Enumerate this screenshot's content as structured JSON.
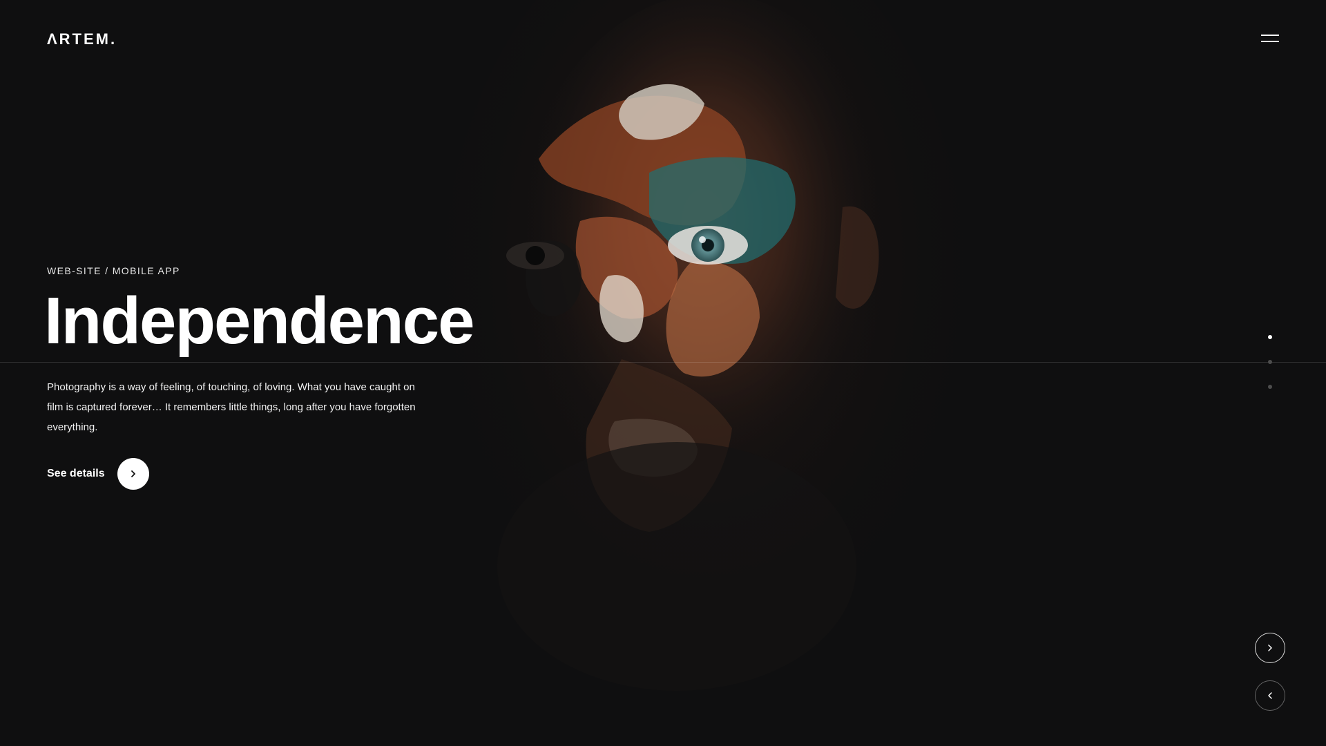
{
  "brand": {
    "logo_text": "ΛRTEM."
  },
  "header": {
    "menu_icon": "hamburger-menu-icon"
  },
  "hero": {
    "category": "WEB-SITE / MOBILE APP",
    "title": "Independence",
    "description": "Photography is a way of feeling, of touching, of loving. What you have caught on film is captured forever… It remembers little things, long after you have forgotten everything.",
    "cta_label": "See details",
    "cta_icon": "chevron-right-icon"
  },
  "slider": {
    "total_slides": 3,
    "active_slide": 1,
    "next_icon": "chevron-right-icon",
    "prev_icon": "chevron-left-icon"
  },
  "colors": {
    "background": "#0f0f10",
    "text": "#ffffff",
    "accent_paint_orange": "#b5562a",
    "accent_paint_teal": "#1f6f72"
  }
}
